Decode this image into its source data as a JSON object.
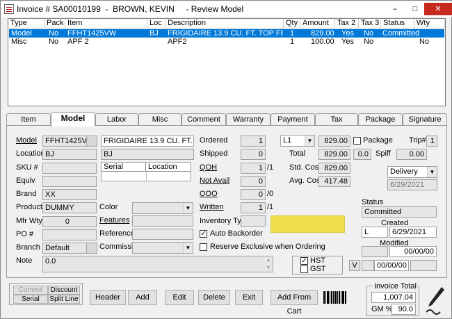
{
  "window": {
    "title": "Invoice # SA00010199  -  BROWN, KEVIN     - Review Model",
    "min": "–",
    "max": "□",
    "close": "✕"
  },
  "list": {
    "headers": [
      "Type",
      "Pack",
      "Item",
      "Loc",
      "Description",
      "Qty",
      "Amount",
      "Tax 2",
      "Tax 3",
      "Status",
      "Wty"
    ],
    "rows": [
      [
        "Model",
        "No",
        "FFHT1425VW",
        "BJ",
        "FRIGIDAIRE 13.9 CU. FT. TOP FREE...",
        "1",
        "829.00",
        "Yes",
        "No",
        "Committed",
        ""
      ],
      [
        "Misc",
        "No",
        "APF 2",
        "",
        "APF2",
        "1",
        "100.00",
        "Yes",
        "No",
        "",
        "No"
      ]
    ]
  },
  "tabs": [
    "Item",
    "Model",
    "Labor",
    "Misc",
    "Comment",
    "Warranty",
    "Payment",
    "Tax",
    "Package",
    "Signature"
  ],
  "left": {
    "model_lbl": "Model",
    "model": "FFHT1425VW",
    "desc": "FRIGIDAIRE 13.9 CU. FT. TOP FR",
    "location_lbl": "Location",
    "location": "BJ",
    "location_name": "BJ",
    "sku_lbl": "SKU #",
    "equiv_lbl": "Equiv",
    "brand_lbl": "Brand",
    "brand": "XX",
    "product_lbl": "Product",
    "product": "DUMMY",
    "mfr_lbl": "Mfr Wty",
    "mfr": "0",
    "po_lbl": "PO #",
    "branch_lbl": "Branch",
    "branch": "Default",
    "note_lbl": "Note",
    "note": "0.0",
    "serial_hdr": "Serial",
    "location_hdr": "Location",
    "color_lbl": "Color",
    "features_lbl": "Features",
    "reference_lbl": "Reference",
    "commission_lbl": "Commission"
  },
  "mid": {
    "ordered_lbl": "Ordered",
    "ordered": "1",
    "shipped_lbl": "Shipped",
    "shipped": "0",
    "qoh_lbl": "QOH",
    "qoh": "1",
    "qoh_suffix": "/1",
    "notavail_lbl": "Not Avail",
    "notavail": "0",
    "qoo_lbl": "QOO",
    "qoo": "0",
    "qoo_suffix": "/0",
    "written_lbl": "Written",
    "written": "1",
    "written_suffix": "/1",
    "invtype_lbl": "Inventory Type",
    "auto_backorder": "Auto Backorder",
    "reserve": "Reserve Exclusive when Ordering"
  },
  "price": {
    "level": "L1",
    "price": "829.00",
    "total_lbl": "Total",
    "total": "829.00",
    "total_extra": "0.0",
    "std_lbl": "Std. Cost",
    "std": "829.00",
    "avg_lbl": "Avg. Cost",
    "avg": "417.48",
    "hst": "HST",
    "gst": "GST"
  },
  "right": {
    "package_lbl": "Package",
    "trip_lbl": "Trip#",
    "trip": "1",
    "spiff_lbl": "Spiff",
    "spiff": "0.00",
    "delivery": "Delivery",
    "date": "6/29/2021",
    "status_lbl": "Status",
    "status": "Committed",
    "created_lbl": "Created",
    "created_by": "L",
    "created": "6/29/2021",
    "modified_lbl": "Modified",
    "modified": "00/00/00",
    "v_lbl": "V",
    "v_date": "00/00/00"
  },
  "buttons": {
    "commit": "Commit",
    "discount": "Discount",
    "serial": "Serial",
    "split": "Split Line",
    "header": "Header",
    "add": "Add",
    "edit": "Edit",
    "delete": "Delete",
    "exit": "Exit",
    "add_cart": "Add From Cart"
  },
  "totals": {
    "invoice_total_lbl": "Invoice Total",
    "invoice_total": "1,007.04",
    "gm_lbl": "GM %",
    "gm": "90.0"
  }
}
